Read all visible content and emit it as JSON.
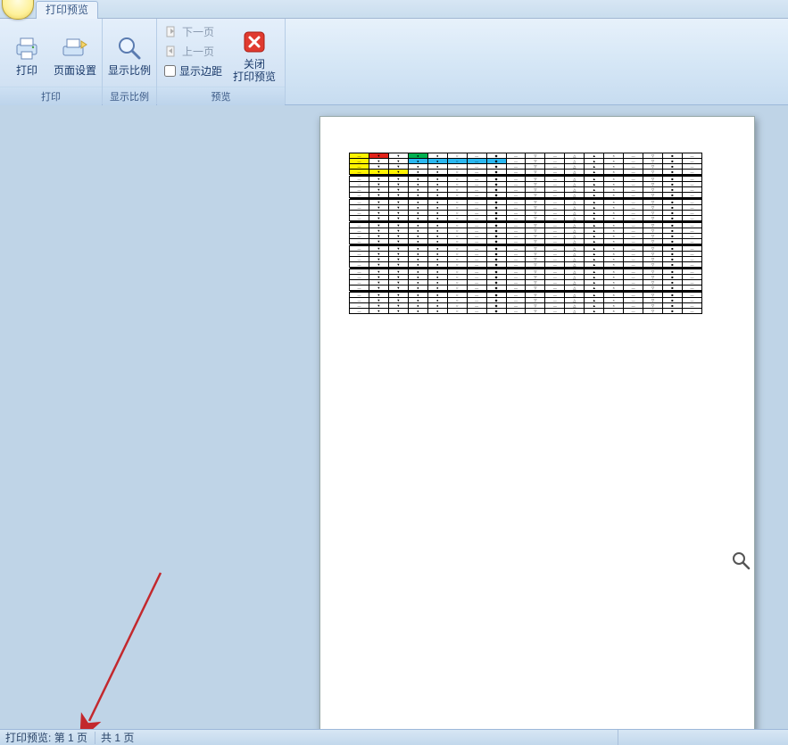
{
  "tab": {
    "title": "打印预览"
  },
  "ribbon": {
    "group_print": {
      "label": "打印",
      "print_btn": "打印",
      "page_setup_btn": "页面设置"
    },
    "group_zoom": {
      "label": "显示比例",
      "zoom_btn": "显示比例"
    },
    "group_preview": {
      "label": "预览",
      "next_page": "下一页",
      "prev_page": "上一页",
      "show_margins": "显示边距",
      "close_btn_line1": "关闭",
      "close_btn_line2": "打印预览"
    }
  },
  "statusbar": {
    "prefix": "打印预览:",
    "page_current": "第 1 页",
    "page_total": "共 1 页"
  },
  "page_content": {
    "symbols_per_row": [
      "—",
      "▼",
      "▼",
      "●",
      "●",
      "○",
      "—",
      "◆",
      "—",
      "▽",
      "—",
      "△",
      "▲",
      "×",
      "—",
      "▽",
      "■",
      "—"
    ],
    "color_overlay": {
      "col0_rows": [
        0,
        1,
        2,
        3
      ],
      "red_cell": {
        "row": 0,
        "col": 1
      },
      "green_cell": {
        "row": 0,
        "col": 3
      },
      "cyan_cells": [
        {
          "row": 1,
          "col": 3
        },
        {
          "row": 1,
          "col": 4
        },
        {
          "row": 1,
          "col": 5
        },
        {
          "row": 1,
          "col": 6
        },
        {
          "row": 1,
          "col": 7
        }
      ],
      "yellow_row3": [
        1,
        2
      ]
    },
    "row_blocks": 7,
    "rows_per_block": 4
  }
}
